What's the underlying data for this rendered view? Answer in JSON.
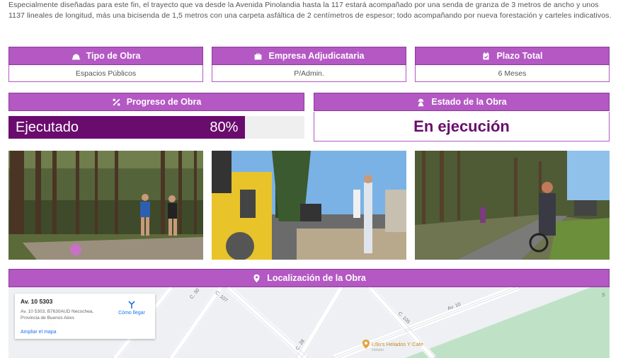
{
  "intro_text": "Especialmente diseñadas para este fin, el trayecto que va desde la Avenida Pinolandia hasta la 117 estará acompañado por una senda de granza de 3 metros de ancho y unos 1137 lineales de longitud, más una bicisenda de 1,5 metros con una carpeta asfáltica de 2 centímetros de espesor; todo acompañando por nueva forestación y carteles indicativos.",
  "info_cards": [
    {
      "title": "Tipo de Obra",
      "icon": "helmet-icon",
      "value": "Espacios Públicos"
    },
    {
      "title": "Empresa Adjudicataria",
      "icon": "briefcase-icon",
      "value": "P/Admin."
    },
    {
      "title": "Plazo Total",
      "icon": "calendar-icon",
      "value": "6 Meses"
    }
  ],
  "progress": {
    "title": "Progreso de Obra",
    "icon": "percent-icon",
    "label": "Ejecutado",
    "percent_text": "80%",
    "percent": 80
  },
  "estado": {
    "title": "Estado de la Obra",
    "icon": "worker-icon",
    "value": "En ejecución"
  },
  "photos": [
    "pinewood-walkers-photo",
    "road-roller-photo",
    "bike-path-photo"
  ],
  "location": {
    "title": "Localización de la Obra",
    "icon": "map-pin-icon",
    "map": {
      "address": "Av. 10 5303",
      "full_address": "Av. 10 5303, B7630AUD Necochea, Provincia de Buenos Aires",
      "directions_label": "Cómo llegar",
      "enlarge_label": "Ampliar el mapa",
      "streets": [
        "C. 30",
        "C. 107",
        "C. 105",
        "Av. 10",
        "C. 28"
      ],
      "poi_name": "Lillo's Helados Y Cafe",
      "poi_sub": "Helado",
      "corner_label": "S"
    }
  },
  "colors": {
    "header_purple": "#b458c4",
    "dark_purple": "#6a0b6e"
  }
}
